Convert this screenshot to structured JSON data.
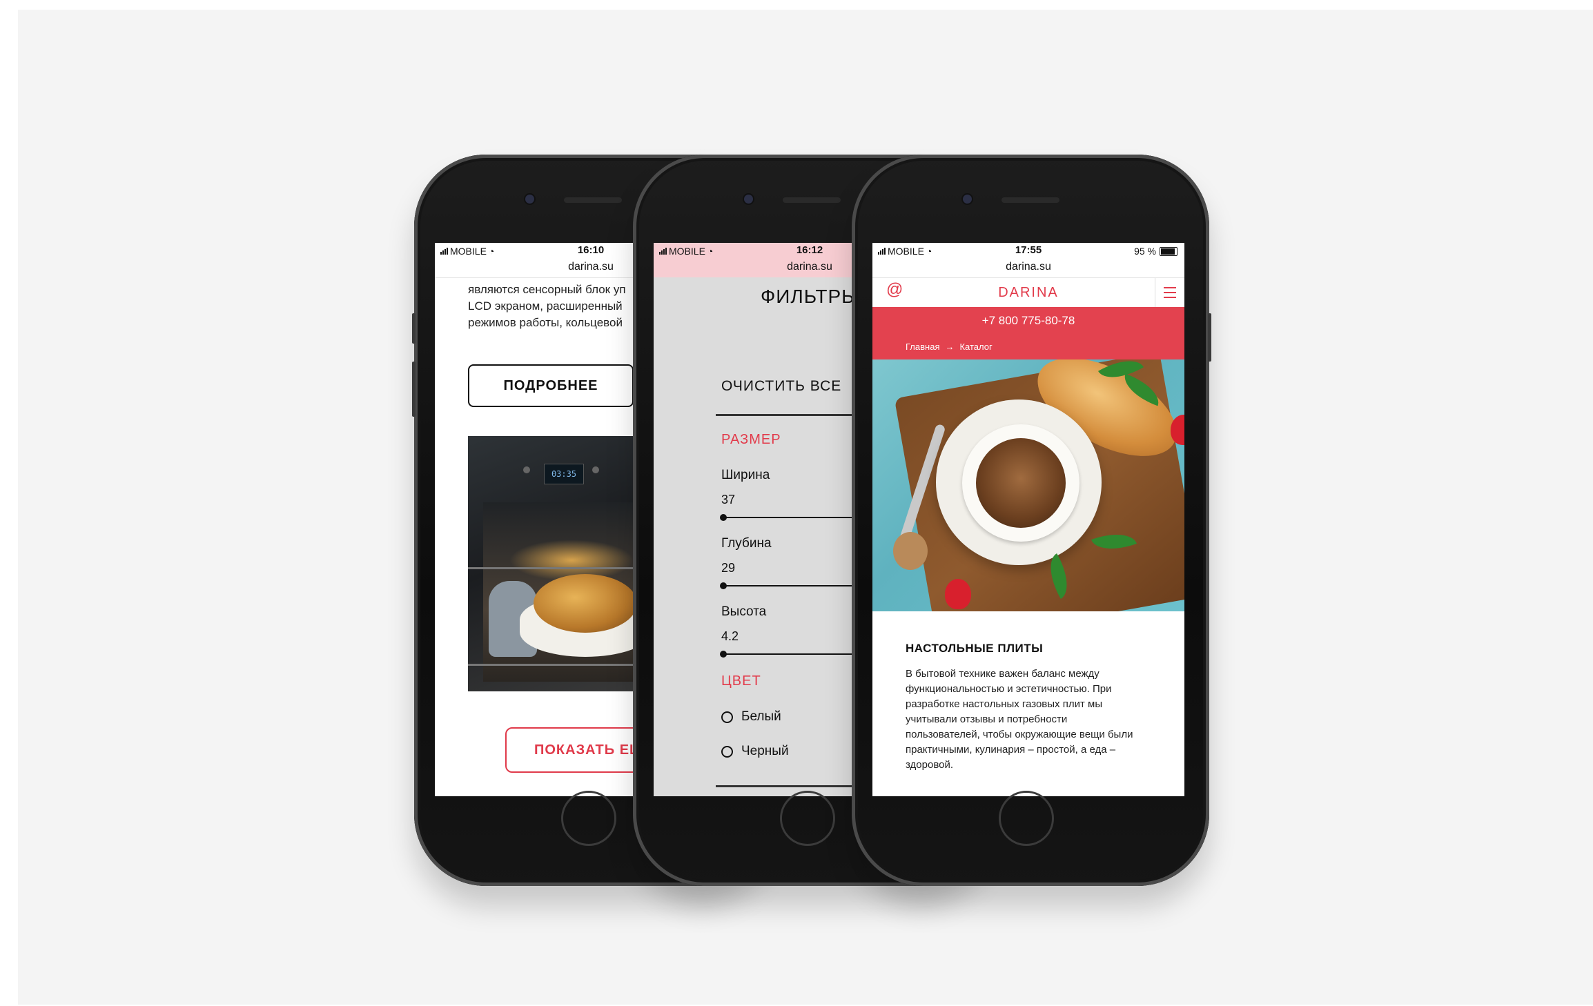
{
  "phone1": {
    "status": {
      "carrier": "MOBILE",
      "time": "16:10"
    },
    "url": "darina.su",
    "text_lines": [
      "являются сенсорный блок уп",
      "LCD экраном, расширенный",
      "режимов работы, кольцевой"
    ],
    "more_button": "ПОДРОБНЕЕ",
    "oven_display": "03:35",
    "show_more_button": "ПОКАЗАТЬ ЕЩ"
  },
  "phone2": {
    "status": {
      "carrier": "MOBILE",
      "time": "16:12"
    },
    "url": "darina.su",
    "title": "ФИЛЬТРЫ",
    "clear_all": "ОЧИСТИТЬ ВСЕ",
    "size_section": "РАЗМЕР",
    "width_label": "Ширина",
    "width_value": "37",
    "depth_label": "Глубина",
    "depth_value": "29",
    "height_label": "Высота",
    "height_value": "4.2",
    "color_section": "ЦВЕТ",
    "color_options": [
      "Белый",
      "Черный"
    ]
  },
  "phone3": {
    "status": {
      "carrier": "MOBILE",
      "time": "17:55",
      "battery": "95 %"
    },
    "url": "darina.su",
    "logo": "DARINA",
    "phone_number": "+7 800 775-80-78",
    "breadcrumb": {
      "home": "Главная",
      "separator": "→",
      "current": "Каталог"
    },
    "heading": "НАСТОЛЬНЫЕ ПЛИТЫ",
    "body_lines": [
      "В бытовой технике важен баланс между",
      "функциональностью и эстетичностью. При",
      "разработке настольных газовых плит мы",
      "учитывали отзывы и потребности",
      "пользователей, чтобы окружающие вещи были",
      "практичными, кулинария – простой, а еда –",
      "здоровой."
    ]
  },
  "colors": {
    "accent": "#e3424f",
    "pink_bar": "#f7cdd2",
    "filter_bg": "#dcdcdc"
  }
}
